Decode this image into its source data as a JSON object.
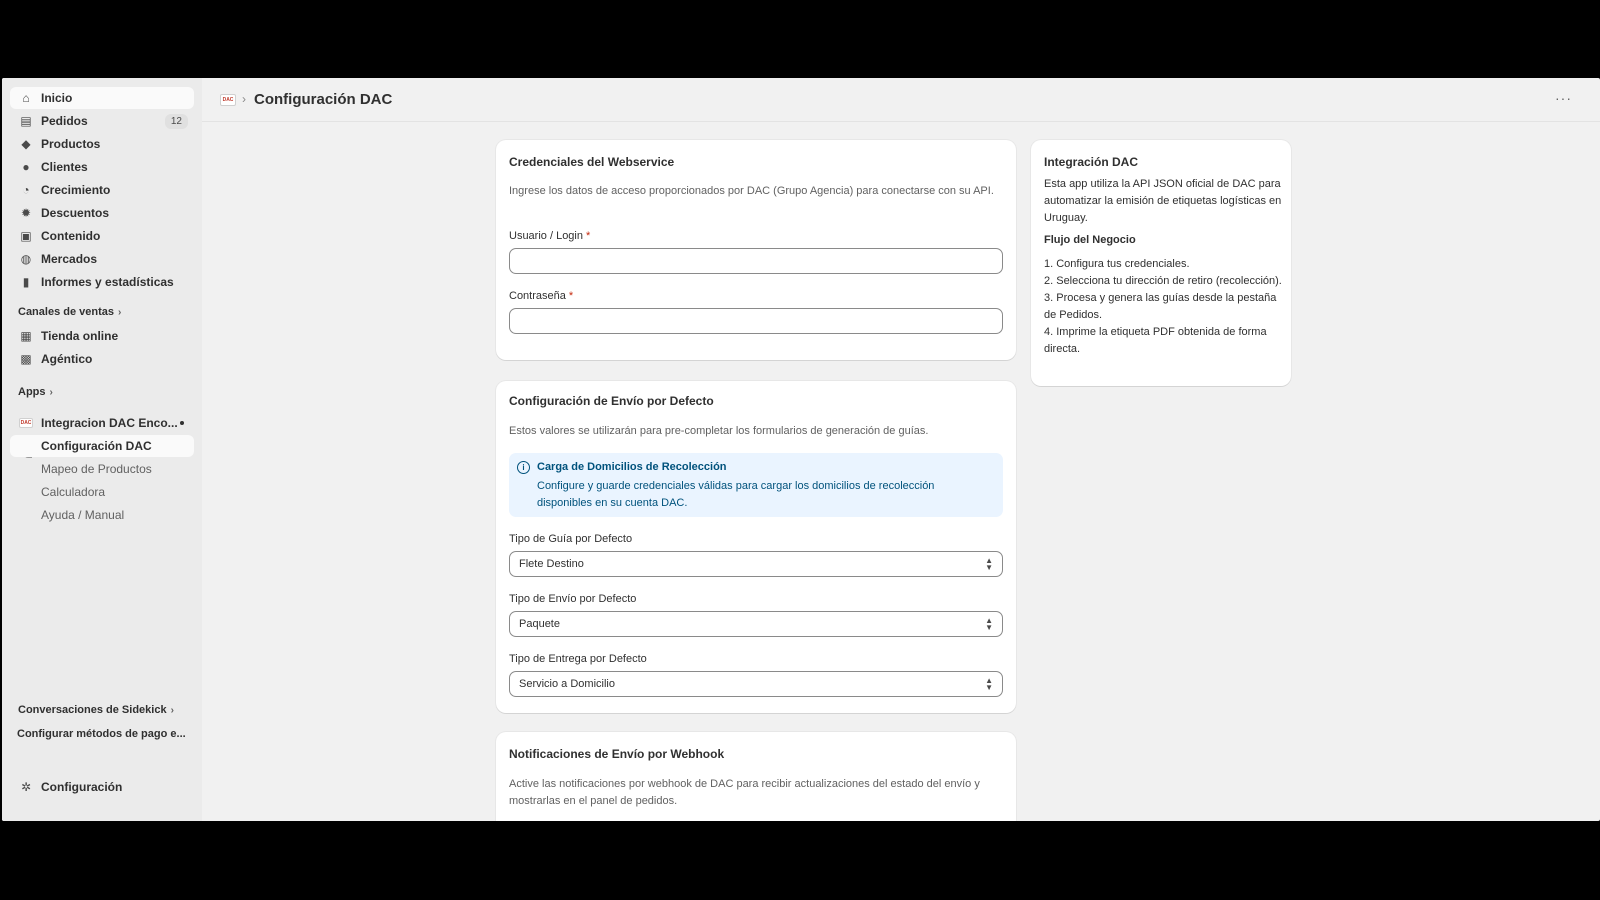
{
  "header": {
    "title": "Configuración DAC",
    "logo_text": "DAC",
    "separator": "›",
    "more": "···"
  },
  "sidebar": {
    "items": [
      {
        "label": "Inicio",
        "icon": "home-icon",
        "glyph": "⌂"
      },
      {
        "label": "Pedidos",
        "icon": "orders-icon",
        "glyph": "▤",
        "badge": "12"
      },
      {
        "label": "Productos",
        "icon": "tag-icon",
        "glyph": "◆"
      },
      {
        "label": "Clientes",
        "icon": "person-icon",
        "glyph": "●"
      },
      {
        "label": "Crecimiento",
        "icon": "gauge-icon",
        "glyph": "◔"
      },
      {
        "label": "Descuentos",
        "icon": "discount-icon",
        "glyph": "✹"
      },
      {
        "label": "Contenido",
        "icon": "content-icon",
        "glyph": "▣"
      },
      {
        "label": "Mercados",
        "icon": "globe-icon",
        "glyph": "◍"
      },
      {
        "label": "Informes y estadísticas",
        "icon": "bar-chart-icon",
        "glyph": "▮"
      }
    ],
    "sales_channels_heading": "Canales de ventas",
    "sales_channels": [
      {
        "label": "Tienda online",
        "icon": "store-icon",
        "glyph": "▦"
      },
      {
        "label": "Agéntico",
        "icon": "robot-icon",
        "glyph": "▩"
      }
    ],
    "apps_heading": "Apps",
    "app": {
      "label": "Integracion DAC Enco...",
      "logo_text": "DAC",
      "subitems": [
        {
          "label": "Configuración DAC"
        },
        {
          "label": "Mapeo de Productos"
        },
        {
          "label": "Calculadora"
        },
        {
          "label": "Ayuda / Manual"
        }
      ]
    },
    "sidekick_heading": "Conversaciones de Sidekick",
    "payment_link": "Configurar métodos de pago e...",
    "settings": {
      "label": "Configuración",
      "icon": "gear-icon",
      "glyph": "✲"
    },
    "chevron": "›"
  },
  "credentials_card": {
    "title": "Credenciales del Webservice",
    "description": "Ingrese los datos de acceso proporcionados por DAC (Grupo Agencia) para conectarse con su API.",
    "user_label": "Usuario / Login",
    "password_label": "Contraseña",
    "required_mark": "*",
    "user_value": "",
    "password_value": ""
  },
  "shipping_card": {
    "title": "Configuración de Envío por Defecto",
    "description": "Estos valores se utilizarán para pre-completar los formularios de generación de guías.",
    "banner_title": "Carga de Domicilios de Recolección",
    "banner_text": "Configure y guarde credenciales válidas para cargar los domicilios de recolección disponibles en su cuenta DAC.",
    "banner_icon_glyph": "i",
    "guide_type_label": "Tipo de Guía por Defecto",
    "guide_type_value": "Flete Destino",
    "shipment_type_label": "Tipo de Envío por Defecto",
    "shipment_type_value": "Paquete",
    "delivery_type_label": "Tipo de Entrega por Defecto",
    "delivery_type_value": "Servicio a Domicilio"
  },
  "webhook_card": {
    "title": "Notificaciones de Envío por Webhook",
    "description": "Active las notificaciones por webhook de DAC para recibir actualizaciones del estado del envío y mostrarlas en el panel de pedidos."
  },
  "info_card": {
    "title": "Integración DAC",
    "description": "Esta app utiliza la API JSON oficial de DAC para automatizar la emisión de etiquetas logísticas en Uruguay.",
    "flow_heading": "Flujo del Negocio",
    "steps": [
      "1. Configura tus credenciales.",
      "2. Selecciona tu dirección de retiro (recolección).",
      "3. Procesa y genera las guías desde la pestaña de Pedidos.",
      "4. Imprime la etiqueta PDF obtenida de forma directa."
    ]
  }
}
